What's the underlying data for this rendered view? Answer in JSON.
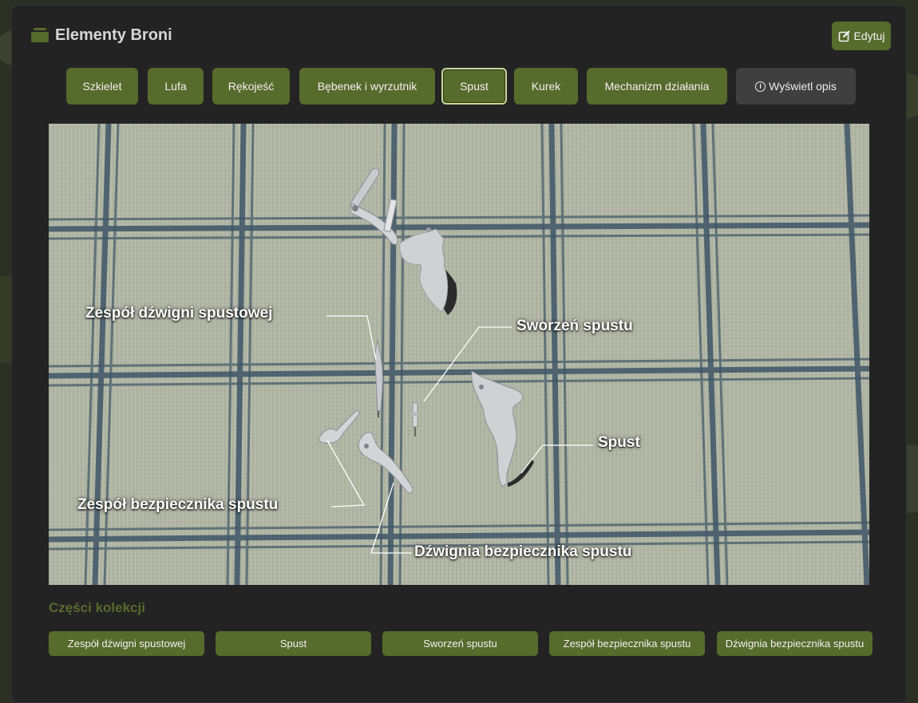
{
  "app": {
    "title": "Elementy Broni",
    "edit_label": "Edytuj"
  },
  "tabs": [
    {
      "label": "Szkielet",
      "active": false
    },
    {
      "label": "Lufa",
      "active": false
    },
    {
      "label": "Rękojeść",
      "active": false
    },
    {
      "label": "Bębenek i wyrzutnik",
      "active": false
    },
    {
      "label": "Spust",
      "active": true
    },
    {
      "label": "Kurek",
      "active": false
    },
    {
      "label": "Mechanizm działania",
      "active": false
    }
  ],
  "info_button": {
    "label": "Wyświetl opis",
    "icon": "info-icon"
  },
  "image_labels": {
    "trigger_lever_assembly": "Zespół dźwigni spustowej",
    "trigger_pin": "Sworzeń spustu",
    "trigger": "Spust",
    "trigger_safety_assembly": "Zespół bezpiecznika spustu",
    "trigger_safety_lever": "Dźwignia bezpiecznika spustu"
  },
  "collection": {
    "title": "Części kolekcji",
    "parts": [
      "Zespół dźwigni spustowej",
      "Spust",
      "Sworzeń spustu",
      "Zespół bezpiecznika spustu",
      "Dźwignia bezpiecznika spustu"
    ]
  },
  "colors": {
    "accent": "#566b2c",
    "panel": "#232323",
    "info_button": "#3f3f3f",
    "section_title": "#566b2c"
  }
}
